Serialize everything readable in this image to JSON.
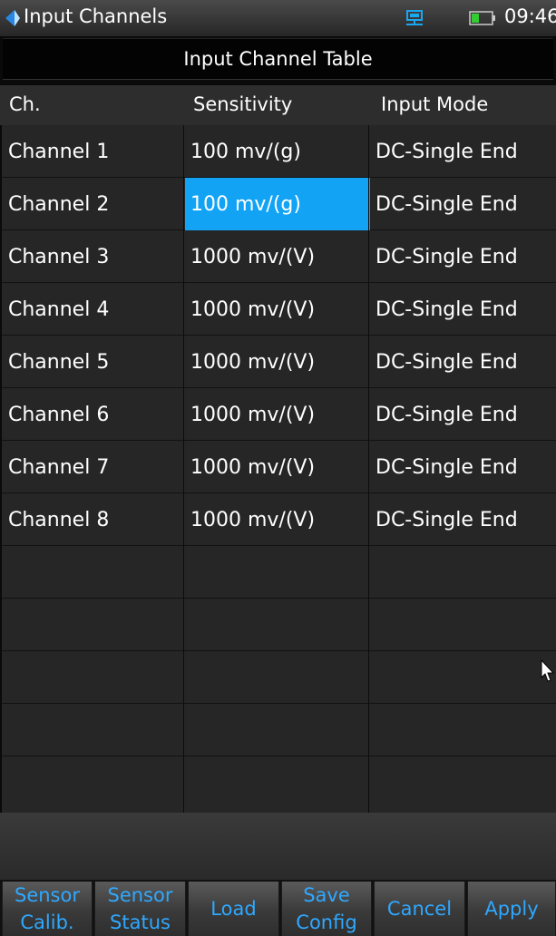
{
  "statusbar": {
    "app_title": "Input Channels",
    "time": "09:46",
    "app_icon": "back-arrow-icon",
    "network_icon": "network-icon",
    "battery_icon": "battery-icon"
  },
  "table": {
    "title": "Input Channel Table",
    "columns": [
      "Ch.",
      "Sensitivity",
      "Input Mode"
    ],
    "rows": [
      {
        "channel": "Channel 1",
        "sensitivity": "100 mv/(g)",
        "mode": "DC-Single End"
      },
      {
        "channel": "Channel 2",
        "sensitivity": "100 mv/(g)",
        "mode": "DC-Single End"
      },
      {
        "channel": "Channel 3",
        "sensitivity": "1000 mv/(V)",
        "mode": "DC-Single End"
      },
      {
        "channel": "Channel 4",
        "sensitivity": "1000 mv/(V)",
        "mode": "DC-Single End"
      },
      {
        "channel": "Channel 5",
        "sensitivity": "1000 mv/(V)",
        "mode": "DC-Single End"
      },
      {
        "channel": "Channel 6",
        "sensitivity": "1000 mv/(V)",
        "mode": "DC-Single End"
      },
      {
        "channel": "Channel 7",
        "sensitivity": "1000 mv/(V)",
        "mode": "DC-Single End"
      },
      {
        "channel": "Channel 8",
        "sensitivity": "1000 mv/(V)",
        "mode": "DC-Single End"
      }
    ],
    "selected": {
      "row": 2,
      "column": "Sensitivity"
    }
  },
  "softkeys": [
    {
      "line1": "Sensor",
      "line2": "Calib."
    },
    {
      "line1": "Sensor",
      "line2": "Status"
    },
    {
      "line1": "Load",
      "line2": ""
    },
    {
      "line1": "Save",
      "line2": "Config"
    },
    {
      "line1": "Cancel",
      "line2": ""
    },
    {
      "line1": "Apply",
      "line2": ""
    }
  ],
  "colors": {
    "selection": "#12a3f5",
    "softkey_text": "#2fa8ff",
    "status_icons": "#1aa7f0",
    "battery": "#33cc33"
  }
}
